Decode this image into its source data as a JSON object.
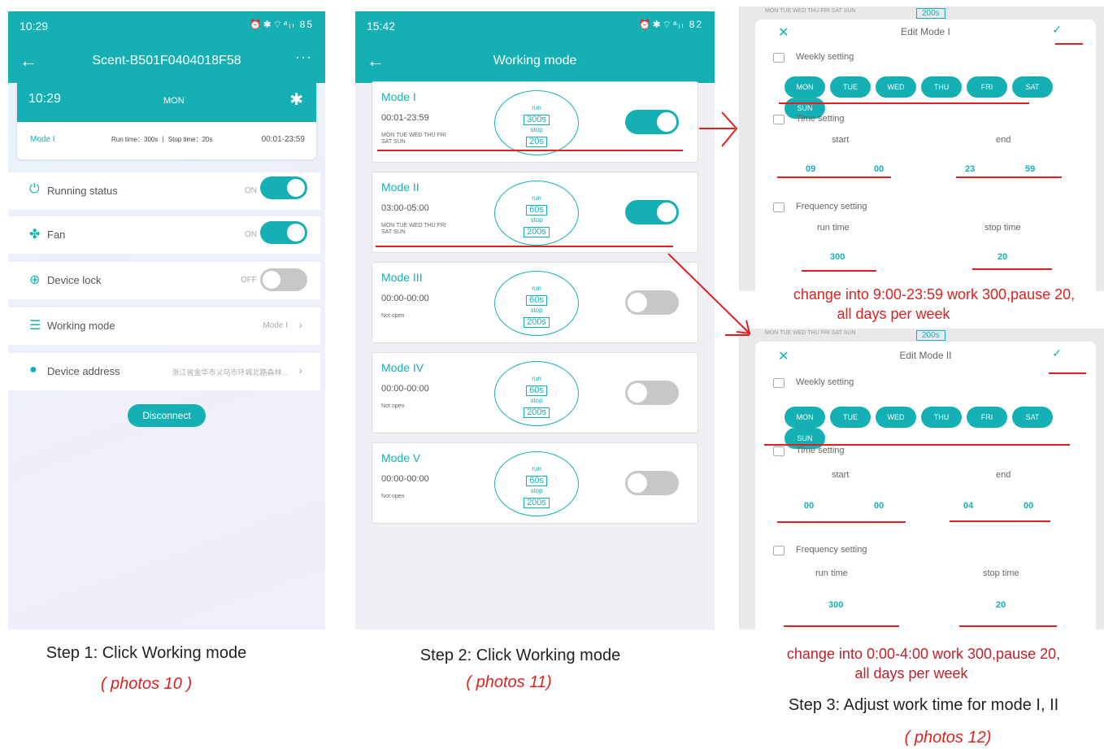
{
  "phone1": {
    "status_time": "10:29",
    "status_icons": "⏰✱⌔ᵃᵢₗ 85",
    "title": "Scent-B501F0404018F58",
    "more": "···",
    "card": {
      "time": "10:29",
      "day": "MON",
      "mode": "Mode I",
      "run": "Run time：300s  丨  Stop time：20s",
      "range": "00:01-23:59"
    },
    "rows": [
      {
        "label": "Running status",
        "state": "ON"
      },
      {
        "label": "Fan",
        "state": "ON"
      },
      {
        "label": "Device lock",
        "state": "OFF"
      },
      {
        "label": "Working mode",
        "value": "Mode I"
      },
      {
        "label": "Device address",
        "value": "浙江省金华市义乌市环城北路森林..."
      }
    ],
    "disconnect": "Disconnect"
  },
  "phone2": {
    "status_time": "15:42",
    "status_icons": "⏰✱⌔ᵃᵢₗ 82",
    "title": "Working mode",
    "modes": [
      {
        "title": "Mode I",
        "range": "00:01-23:59",
        "days": "MON TUE WED THU FRI SAT SUN",
        "run": "300s",
        "stop": "20s",
        "on": true
      },
      {
        "title": "Mode II",
        "range": "03:00-05:00",
        "days": "MON TUE WED THU FRI SAT SUN",
        "run": "60s",
        "stop": "200s",
        "on": true
      },
      {
        "title": "Mode III",
        "range": "00:00-00:00",
        "days": "Not open",
        "run": "60s",
        "stop": "200s",
        "on": false
      },
      {
        "title": "Mode IV",
        "range": "00:00-00:00",
        "days": "Not open",
        "run": "60s",
        "stop": "200s",
        "on": false
      },
      {
        "title": "Mode V",
        "range": "00:00-00:00",
        "days": "Not open",
        "run": "60s",
        "stop": "200s",
        "on": false
      }
    ],
    "run_label": "run",
    "stop_label": "stop"
  },
  "edit1": {
    "ghost_days": "MON TUE WED THU FRI SAT SUN",
    "ghost_box": "200s",
    "title": "Edit Mode I",
    "weekly": "Weekly setting",
    "days": [
      "MON",
      "TUE",
      "WED",
      "THU",
      "FRI",
      "SAT",
      "SUN"
    ],
    "time_setting": "Time setting",
    "start": "start",
    "end": "end",
    "start_h": "09",
    "start_m": "00",
    "end_h": "23",
    "end_m": "59",
    "frequency": "Frequency setting",
    "run_time": "run time",
    "stop_time": "stop time",
    "run_val": "300",
    "stop_val": "20"
  },
  "edit2": {
    "ghost_days": "MON TUE WED THU FRI SAT SUN",
    "ghost_box": "200s",
    "title": "Edit Mode II",
    "weekly": "Weekly setting",
    "days": [
      "MON",
      "TUE",
      "WED",
      "THU",
      "FRI",
      "SAT",
      "SUN"
    ],
    "time_setting": "Time setting",
    "start": "start",
    "end": "end",
    "start_h": "00",
    "start_m": "00",
    "end_h": "04",
    "end_m": "00",
    "frequency": "Frequency setting",
    "run_time": "run time",
    "stop_time": "stop time",
    "run_val": "300",
    "stop_val": "20"
  },
  "captions": {
    "step1": "Step 1: Click Working mode",
    "photos1": "( photos 10 )",
    "step2": "Step 2: Click Working mode",
    "photos2": "( photos 11)",
    "note1": "change into 9:00-23:59 work 300,pause 20,",
    "note1b": "all days per week",
    "note2": "change into 0:00-4:00 work 300,pause 20,",
    "note2b": "all days per week",
    "step3": "Step 3: Adjust work time for mode I, II",
    "photos3": "( photos 12)"
  },
  "colors": {
    "accent": "#14b0b3",
    "highlight": "#e02020"
  }
}
